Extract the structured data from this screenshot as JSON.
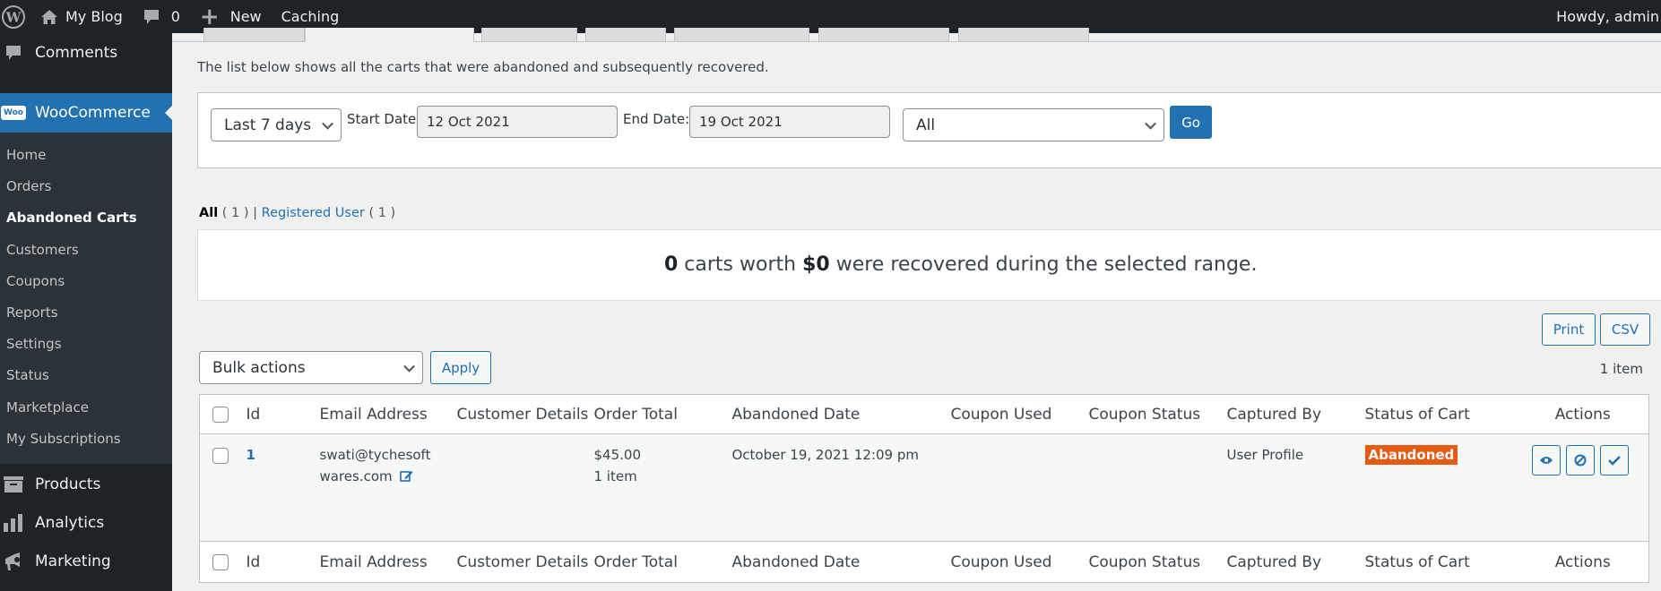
{
  "adminbar": {
    "site_name": "My Blog",
    "comments_count": "0",
    "new_label": "New",
    "caching_label": "Caching",
    "howdy": "Howdy, admin"
  },
  "sidebar": {
    "comments": "Comments",
    "woocommerce": "WooCommerce",
    "woo_logo_text": "Woo",
    "submenu": [
      {
        "label": "Home",
        "current": false
      },
      {
        "label": "Orders",
        "current": false
      },
      {
        "label": "Abandoned Carts",
        "current": true
      },
      {
        "label": "Customers",
        "current": false
      },
      {
        "label": "Coupons",
        "current": false
      },
      {
        "label": "Reports",
        "current": false
      },
      {
        "label": "Settings",
        "current": false
      },
      {
        "label": "Status",
        "current": false
      },
      {
        "label": "Marketplace",
        "current": false
      },
      {
        "label": "My Subscriptions",
        "current": false
      }
    ],
    "products": "Products",
    "analytics": "Analytics",
    "marketing": "Marketing"
  },
  "page": {
    "description": "The list below shows all the carts that were abandoned and subsequently recovered.",
    "filters": {
      "range_selected": "Last 7 days",
      "start_label": "Start Date:",
      "start_value": "12 Oct 2021",
      "end_label": "End Date:",
      "end_value": "19 Oct 2021",
      "type_selected": "All",
      "go_label": "Go"
    },
    "views": {
      "all_label": "All",
      "all_count": "( 1 )",
      "separator": "|",
      "registered_label": "Registered User",
      "registered_count": "( 1 )"
    },
    "summary": {
      "carts_count": "0",
      "text1": " carts worth ",
      "amount": "$0",
      "text2": " were recovered during the selected range."
    },
    "print_label": "Print",
    "csv_label": "CSV",
    "bulk_actions": "Bulk actions",
    "apply_label": "Apply",
    "items_count": "1 item"
  },
  "table": {
    "columns": [
      "Id",
      "Email Address",
      "Customer Details",
      "Order Total",
      "Abandoned Date",
      "Coupon Used",
      "Coupon Status",
      "Captured By",
      "Status of Cart",
      "Actions"
    ],
    "rows": [
      {
        "id": "1",
        "email_line1": "swati@tychesoft",
        "email_line2": "wares.com",
        "customer_details": "",
        "order_total": "$45.00",
        "order_items": "1 item",
        "abandoned_date": "October 19, 2021 12:09 pm",
        "coupon_used": "",
        "coupon_status": "",
        "captured_by": "User Profile",
        "status": "Abandoned",
        "status_color": "#e55b13",
        "actions": [
          "view-icon",
          "ban-icon",
          "check-icon"
        ]
      }
    ]
  }
}
